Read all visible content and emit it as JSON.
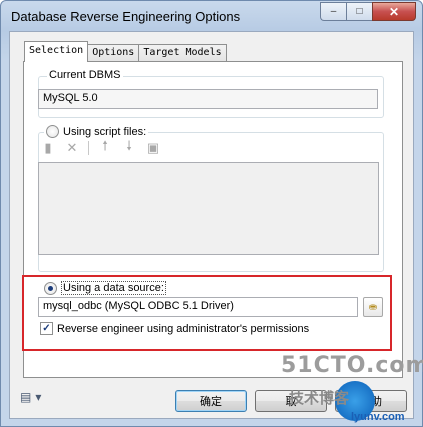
{
  "window": {
    "title": "Database Reverse Engineering Options",
    "minimize_glyph": "–",
    "maximize_glyph": "□",
    "close_glyph": "✕"
  },
  "tabs": [
    {
      "label": "Selection",
      "active": true
    },
    {
      "label": "Options",
      "active": false
    },
    {
      "label": "Target Models",
      "active": false
    }
  ],
  "current_dbms": {
    "label": "Current DBMS",
    "value": "MySQL 5.0"
  },
  "script_files": {
    "radio_label": "Using script files:",
    "selected": false,
    "toolbar_icons": [
      "add-file-icon",
      "delete-icon",
      "move-up-icon",
      "move-down-icon",
      "properties-icon"
    ]
  },
  "data_source": {
    "radio_label": "Using a data source:",
    "selected": true,
    "value": "mysql_odbc (MySQL ODBC 5.1 Driver)",
    "checkbox_label": "Reverse engineer using administrator's permissions",
    "checkbox_checked": true
  },
  "buttons": {
    "ok": "确定",
    "cancel": "取",
    "help": "帮助"
  },
  "watermark": {
    "top": "51CTO.com",
    "bottom": "技术博客",
    "url": "lyunv.com"
  },
  "colors": {
    "highlight": "#d7262a",
    "accent": "#3c7fb1"
  }
}
